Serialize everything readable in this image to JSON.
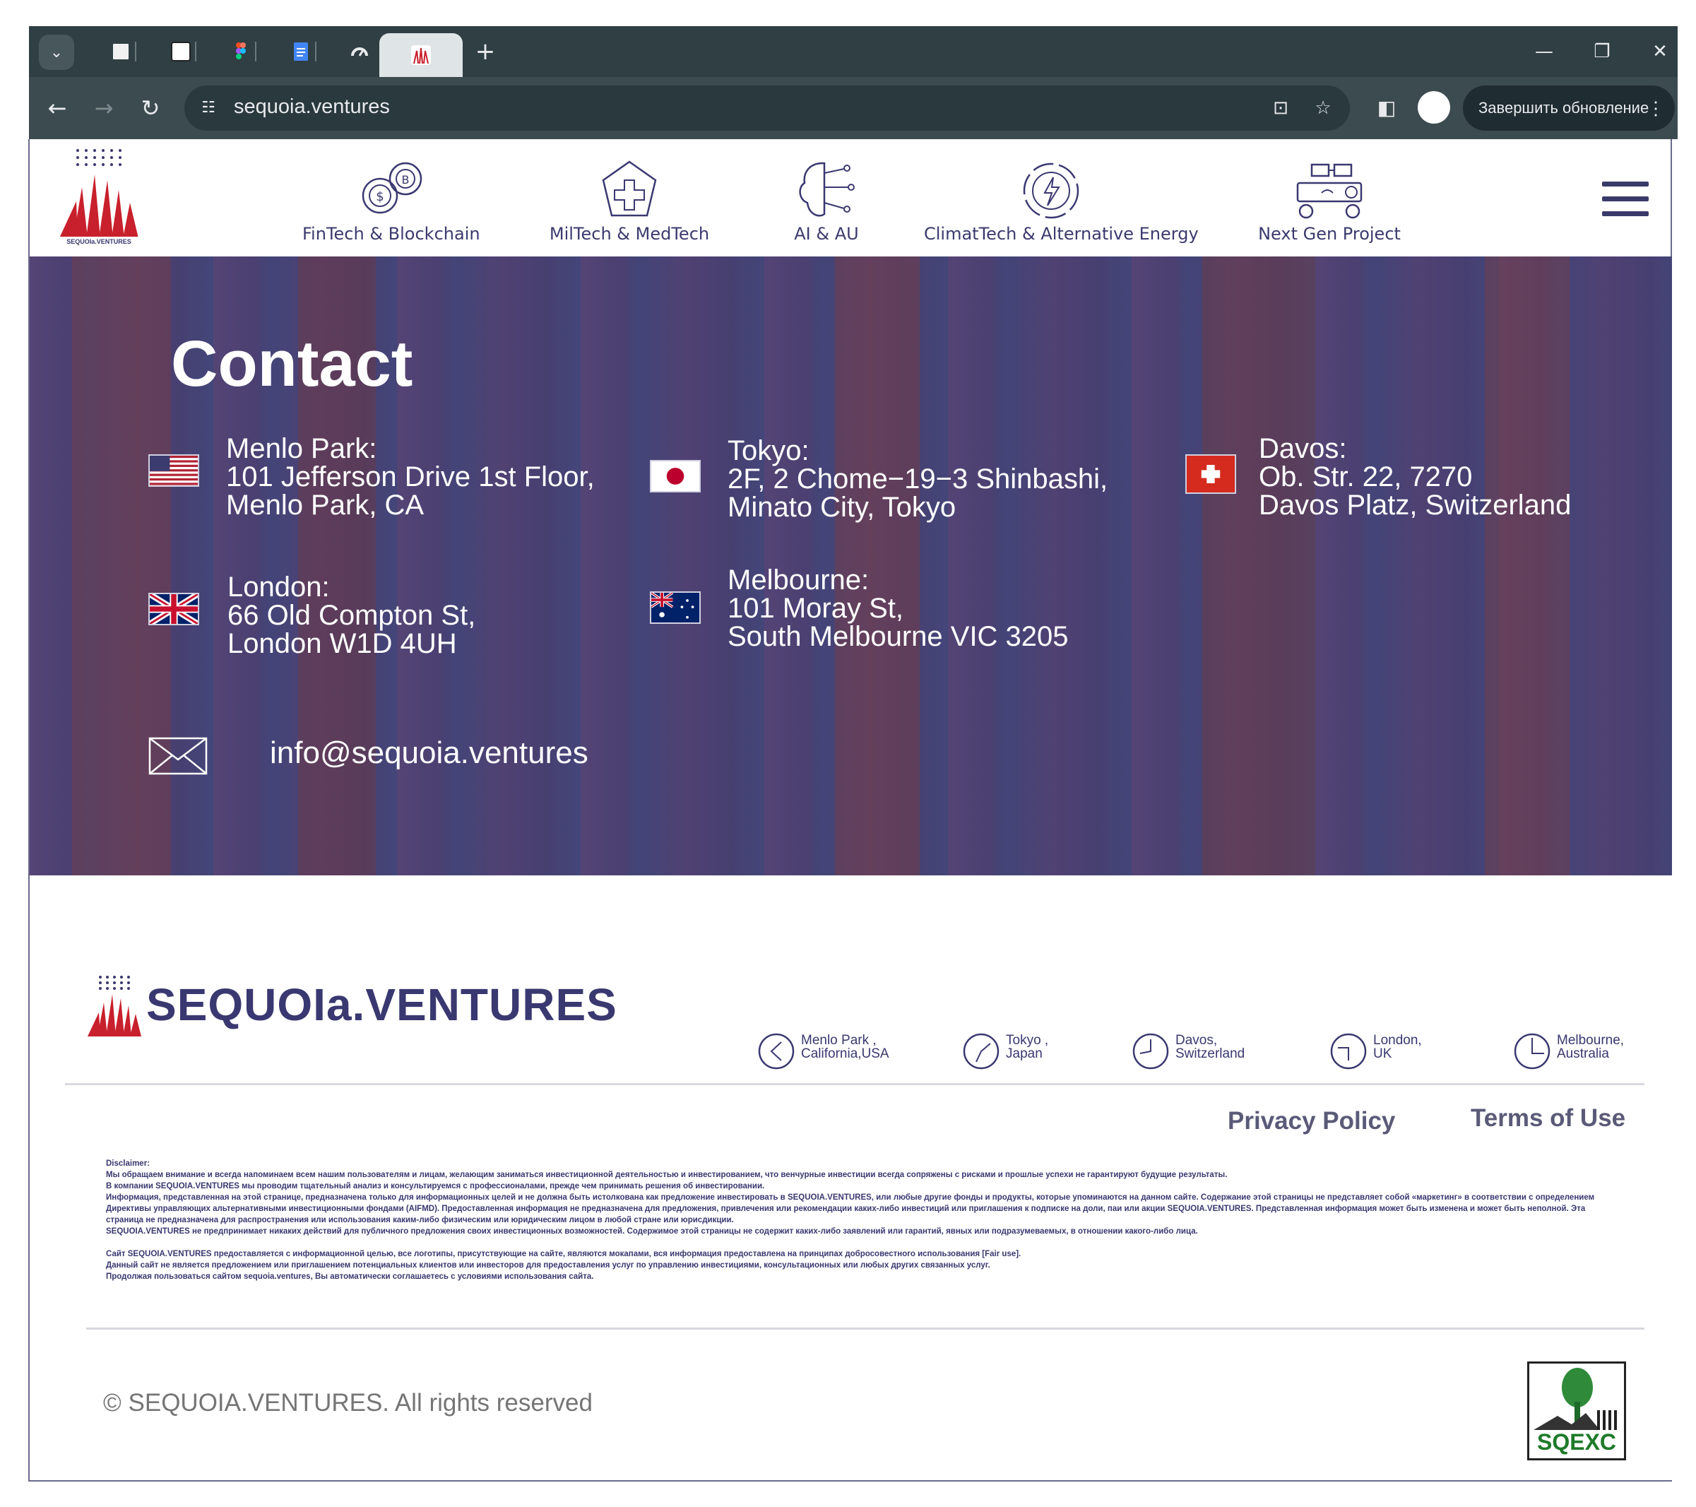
{
  "browser": {
    "url": "sequoia.ventures",
    "update_label": "Завершить обновление"
  },
  "nav": {
    "items": [
      {
        "label": "FinTech & Blockchain"
      },
      {
        "label": "MilTech & MedTech"
      },
      {
        "label": "AI & AU"
      },
      {
        "label": "ClimatTech & Alternative Energy"
      },
      {
        "label": "Next Gen Project"
      }
    ]
  },
  "hero": {
    "title": "Contact",
    "offices": [
      {
        "city": "Menlo Park:",
        "line1": "101 Jefferson Drive 1st Floor,",
        "line2": "Menlo Park, CA"
      },
      {
        "city": "Tokyo:",
        "line1": "2F, 2 Chome−19−3 Shinbashi,",
        "line2": "Minato City, Tokyo"
      },
      {
        "city": "Davos:",
        "line1": "Ob. Str. 22, 7270",
        "line2": "Davos Platz, Switzerland"
      },
      {
        "city": "London:",
        "line1": "66 Old Compton St,",
        "line2": "London W1D 4UH"
      },
      {
        "city": "Melbourne:",
        "line1": "101 Moray St,",
        "line2": "South Melbourne VIC 3205"
      }
    ],
    "email": "info@sequoia.ventures"
  },
  "footer": {
    "brand": "SEQUOIa.VENTURES",
    "clocks": [
      {
        "line1": "Menlo Park ,",
        "line2": "California,USA"
      },
      {
        "line1": "Tokyo ,",
        "line2": "Japan"
      },
      {
        "line1": "Davos,",
        "line2": "Switzerland"
      },
      {
        "line1": "London,",
        "line2": "UK"
      },
      {
        "line1": "Melbourne,",
        "line2": "Australia"
      }
    ],
    "privacy_label": "Privacy Policy",
    "terms_label": "Terms of Use",
    "disclaimer": {
      "heading": "Disclaimer:",
      "p1": "Мы обращаем внимание и всегда напоминаем всем нашим пользователям и лицам, желающим заниматься инвестиционной деятельностью и инвестированием, что венчурные инвестиции всегда сопряжены с рисками и прошлые успехи не гарантируют будущие результаты.",
      "p2": "В компании SEQUOIA.VENTURES мы проводим тщательный анализ и консультируемся с профессионалами, прежде чем принимать решения об инвестировании.",
      "p3": "Информация, представленная на этой странице, предназначена только для информационных целей и не должна быть истолкована как предложение инвестировать в SEQUOIA.VENTURES, или любые другие фонды и продукты, которые упоминаются на данном сайте. Содержание этой страницы не представляет собой «маркетинг» в соответствии с определением Директивы управляющих альтернативными инвестиционными фондами (AIFMD). Предоставленная информация не предназначена для предложения, привлечения или рекомендации каких-либо инвестиций или приглашения к подписке на доли, паи или акции SEQUOIA.VENTURES. Представленная информация может быть изменена и может быть неполной. Эта страница не предназначена для распространения или использования каким-либо физическим или юридическим лицом в любой стране или юрисдикции.",
      "p4": "SEQUOIA.VENTURES не предпринимает никаких действий для публичного предложения своих инвестиционных возможностей. Содержимое этой страницы не содержит каких-либо заявлений или гарантий, явных или подразумеваемых, в отношении какого-либо лица.",
      "p5": "Сайт SEQUOIA.VENTURES предоставляется с информационной целью, все логотипы, присутствующие на сайте, являются мокапами, вся информация предоставлена на принципах добросовестного использования [Fair use].",
      "p6": "Данный сайт не является предложением или приглашением потенциальных клиентов или инвесторов для предоставления услуг по управлению инвестициями, консультационных или любых других связанных услуг.",
      "p7": "Продолжая пользоваться сайтом sequoia.ventures, Вы автоматически соглашаетесь с условиями использования сайта."
    },
    "copyright": "© SEQUOIA.VENTURES. All rights reserved",
    "badge_text": "SQEXC"
  }
}
